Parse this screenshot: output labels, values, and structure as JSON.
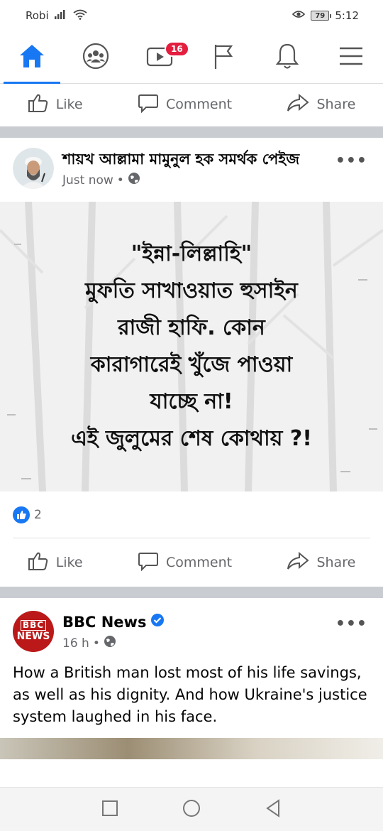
{
  "status_bar": {
    "carrier": "Robi",
    "battery": "79",
    "time": "5:12"
  },
  "navbar": {
    "video_badge": "16"
  },
  "actions": {
    "like": "Like",
    "comment": "Comment",
    "share": "Share"
  },
  "post1": {
    "author": "শায়খ আল্লামা মামুনুল হক সমর্থক পেইজ",
    "time": "Just now",
    "image_lines": [
      "\"ইন্না-লিল্লাহি\"",
      "মুফতি সাখাওয়াত হুসাইন",
      "রাজী হাফি. কোন",
      "কারাগারেই খুঁজে পাওয়া",
      "যাচ্ছে না!",
      "এই জুলুমের শেষ কোথায় ?!"
    ],
    "reaction_count": "2"
  },
  "post2": {
    "author": "BBC News",
    "time": "16 h",
    "logo_top": "BBC",
    "logo_bottom": "NEWS",
    "text": "How a British man lost most of his life savings, as well as his dignity. And how Ukraine's justice system laughed in his face."
  },
  "colors": {
    "accent": "#1877f2",
    "badge": "#e41e3f",
    "bbc_red": "#bb1919"
  }
}
